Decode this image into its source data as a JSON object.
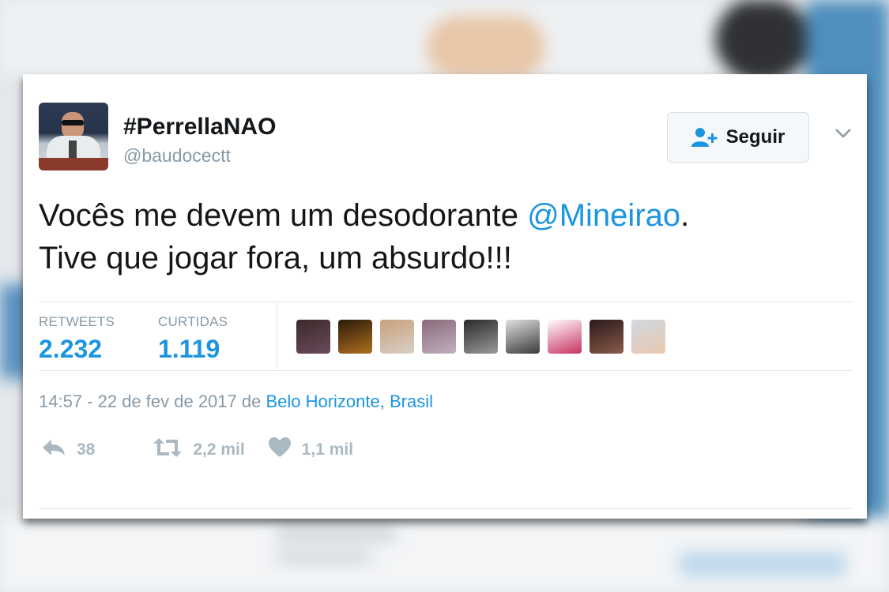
{
  "tweet": {
    "display_name": "#PerrellaNAO",
    "handle": "@baudocectt",
    "follow_label": "Seguir",
    "text_part1": "Vocês me devem um desodorante ",
    "mention": "@Mineirao",
    "text_part2": ".",
    "text_line2": "Tive que jogar fora, um absurdo!!!",
    "retweets_label": "RETWEETS",
    "retweets_count": "2.232",
    "likes_label": "CURTIDAS",
    "likes_count": "1.119",
    "timestamp": "14:57 - 22 de fev de 2017 de ",
    "location": "Belo Horizonte, Brasil",
    "reply_count": "38",
    "retweet_action_count": "2,2 mil",
    "like_action_count": "1,1 mil"
  },
  "colors": {
    "link": "#1b95e0",
    "muted": "#8899a6",
    "action": "#aab8c2"
  },
  "liker_avatars": [
    {
      "name": "liker-avatar-1",
      "c1": "#3b2a2a",
      "c2": "#6a4a5a"
    },
    {
      "name": "liker-avatar-2",
      "c1": "#2a1a0a",
      "c2": "#b07020"
    },
    {
      "name": "liker-avatar-3",
      "c1": "#c9a07a",
      "c2": "#d8d0c8"
    },
    {
      "name": "liker-avatar-4",
      "c1": "#8a6a7a",
      "c2": "#c0b0c0"
    },
    {
      "name": "liker-avatar-5",
      "c1": "#2a2a2a",
      "c2": "#9a9a9a"
    },
    {
      "name": "liker-avatar-6",
      "c1": "#e0e0e0",
      "c2": "#3a3a3a"
    },
    {
      "name": "liker-avatar-7",
      "c1": "#ffffff",
      "c2": "#c83060"
    },
    {
      "name": "liker-avatar-8",
      "c1": "#2a1a1a",
      "c2": "#8a5a4a"
    },
    {
      "name": "liker-avatar-9",
      "c1": "#d0d8e0",
      "c2": "#e8c8b0"
    }
  ]
}
